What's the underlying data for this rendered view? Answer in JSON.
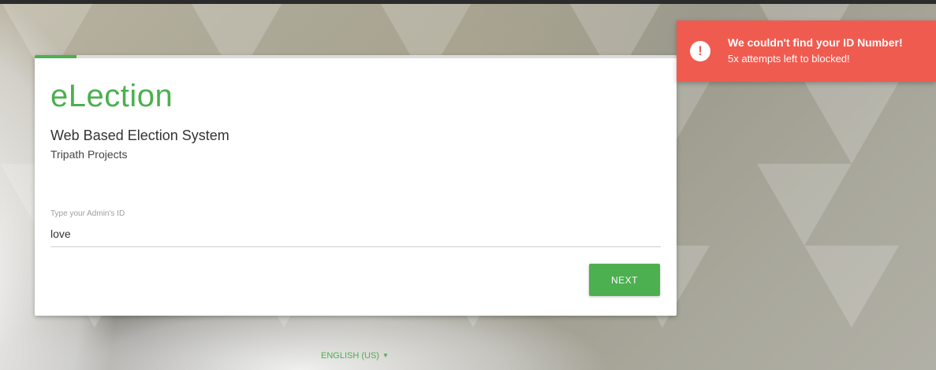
{
  "app": {
    "brand": "eLection",
    "subtitle": "Web Based Election System",
    "organization": "Tripath Projects"
  },
  "progress": {
    "fraction": 0.065
  },
  "form": {
    "id_label": "Type your Admin's ID",
    "id_value": "love",
    "next_label": "NEXT"
  },
  "language": {
    "selected": "ENGLISH (US)"
  },
  "toast": {
    "icon": "exclamation-icon",
    "title": "We couldn't find your ID Number!",
    "message": "5x attempts left to blocked!"
  },
  "colors": {
    "accent": "#4caf50",
    "error": "#f05b50"
  }
}
